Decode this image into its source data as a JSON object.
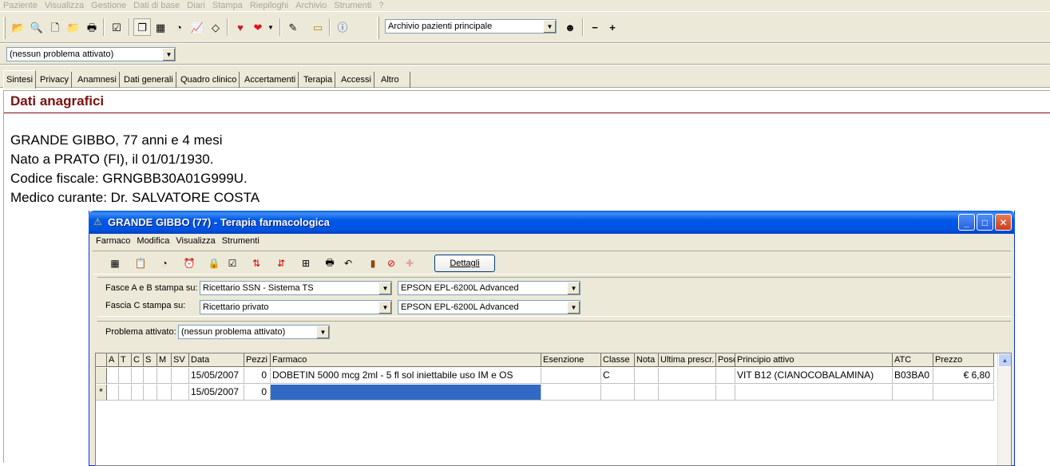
{
  "menubar": [
    "Paziente",
    "Visualizza",
    "Gestione",
    "Dati di base",
    "Diari",
    "Stampa",
    "Riepiloghi",
    "Archivio",
    "Strumenti",
    "?"
  ],
  "toolbar": {
    "archive_combo": "Archivio pazienti principale",
    "icons": [
      "open-folder-icon",
      "search-folder-icon",
      "new-document-icon",
      "open-icon",
      "print-icon",
      "checklist-icon",
      "copy-icon",
      "grid-icon",
      "chart-icon",
      "graph-icon",
      "eraser-icon",
      "heart-icon",
      "heart-red-icon",
      "chevron-down-icon",
      "edit-icon",
      "note-icon",
      "info-icon"
    ]
  },
  "problem_combo": "(nessun problema attivato)",
  "tabs": [
    "Sintesi",
    "Privacy",
    "Anamnesi",
    "Dati generali",
    "Quadro clinico",
    "Accertamenti",
    "Terapia",
    "Accessi",
    "Altro"
  ],
  "section_title": "Dati anagrafici",
  "patient": {
    "line1": "GRANDE GIBBO, 77 anni e 4 mesi",
    "line2": "Nato a PRATO (FI), il 01/01/1930.",
    "line3": "Codice fiscale: GRNGBB30A01G999U.",
    "line4": "Medico curante: Dr. SALVATORE COSTA"
  },
  "dialog": {
    "title": "GRANDE GIBBO (77) - Terapia farmacologica",
    "menu": [
      "Farmaco",
      "Modifica",
      "Visualizza",
      "Strumenti"
    ],
    "details_button": "Dettagli",
    "fasce_ab_label": "Fasce A e B stampa su:",
    "fasce_ab_value": "Ricettario SSN - Sistema TS",
    "fasce_ab_printer": "EPSON EPL-6200L Advanced",
    "fascia_c_label": "Fascia C stampa su:",
    "fascia_c_value": "Ricettario privato",
    "fascia_c_printer": "EPSON EPL-6200L Advanced",
    "problema_label": "Problema attivato:",
    "problema_value": "(nessun problema attivato)"
  },
  "grid": {
    "columns": [
      "",
      "A",
      "T",
      "C",
      "S",
      "M",
      "SV",
      "Data",
      "Pezzi",
      "Farmaco",
      "Esenzione",
      "Classe",
      "Nota",
      "Ultima prescr.",
      "Posol",
      "Principio attivo",
      "ATC",
      "Prezzo"
    ],
    "rows": [
      [
        "",
        "",
        "",
        "",
        "",
        "",
        "",
        "15/05/2007",
        "0",
        "DOBETIN 5000 mcg  2ml - 5 fl sol iniettabile uso IM e OS",
        "",
        "C",
        "",
        "",
        "",
        "VIT B12 (CIANOCOBALAMINA)",
        "B03BA0",
        "€ 6,80"
      ],
      [
        "*",
        "",
        "",
        "",
        "",
        "",
        "",
        "15/05/2007",
        "0",
        "",
        "",
        "",
        "",
        "",
        "",
        "",
        "",
        ""
      ]
    ]
  }
}
